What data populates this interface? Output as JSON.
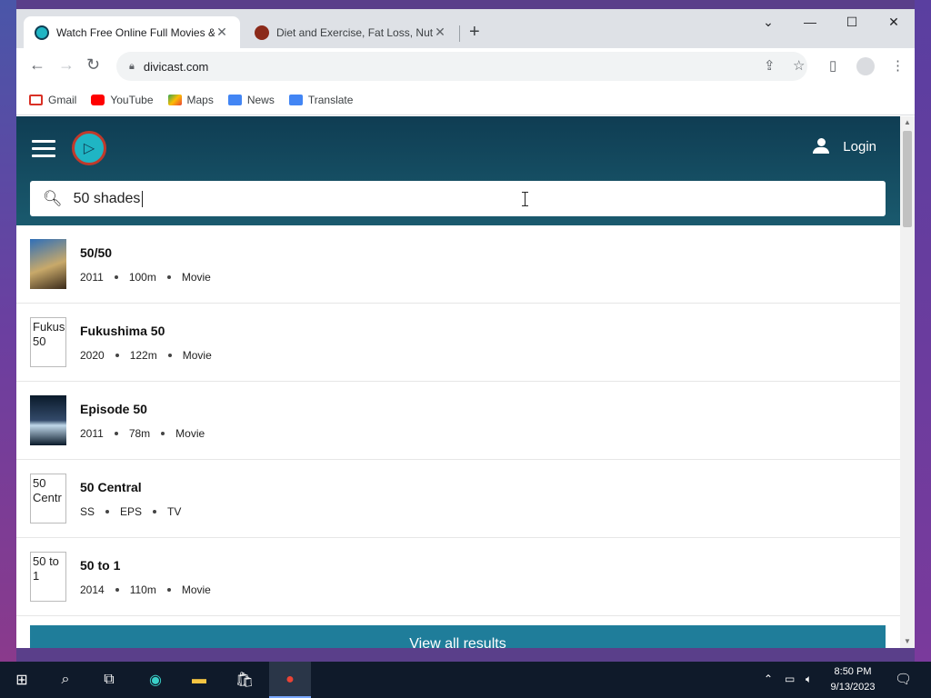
{
  "browser": {
    "tabs": [
      {
        "title": "Watch Free Online Full Movies &",
        "active": true
      },
      {
        "title": "Diet and Exercise, Fat Loss, Nutri",
        "active": false
      }
    ],
    "address": "divicast.com",
    "bookmarks": [
      {
        "label": "Gmail",
        "icon": "gmail-icon",
        "color": "#d93025"
      },
      {
        "label": "YouTube",
        "icon": "youtube-icon",
        "color": "#ff0000"
      },
      {
        "label": "Maps",
        "icon": "maps-icon",
        "color": "#34a853"
      },
      {
        "label": "News",
        "icon": "news-icon",
        "color": "#4285f4"
      },
      {
        "label": "Translate",
        "icon": "translate-icon",
        "color": "#4285f4"
      }
    ]
  },
  "site": {
    "login_label": "Login",
    "search_value": "50 shades ",
    "view_all_label": "View all results",
    "colors": {
      "header": "#0f3d53",
      "button": "#1f7d9a",
      "logo": "#1fb5c4"
    }
  },
  "results": [
    {
      "title": "50/50",
      "meta": [
        "2011",
        "100m",
        "Movie"
      ],
      "poster_alt": "",
      "poster": "image"
    },
    {
      "title": "Fukushima 50",
      "meta": [
        "2020",
        "122m",
        "Movie"
      ],
      "poster_alt": "Fukus 50",
      "poster": "broken"
    },
    {
      "title": "Episode 50",
      "meta": [
        "2011",
        "78m",
        "Movie"
      ],
      "poster_alt": "",
      "poster": "image"
    },
    {
      "title": "50 Central",
      "meta": [
        "SS",
        "EPS",
        "TV"
      ],
      "poster_alt": "50 Centr",
      "poster": "broken"
    },
    {
      "title": "50 to 1",
      "meta": [
        "2014",
        "110m",
        "Movie"
      ],
      "poster_alt": "50 to 1",
      "poster": "broken"
    }
  ],
  "taskbar": {
    "time": "8:50 PM",
    "date": "9/13/2023"
  }
}
